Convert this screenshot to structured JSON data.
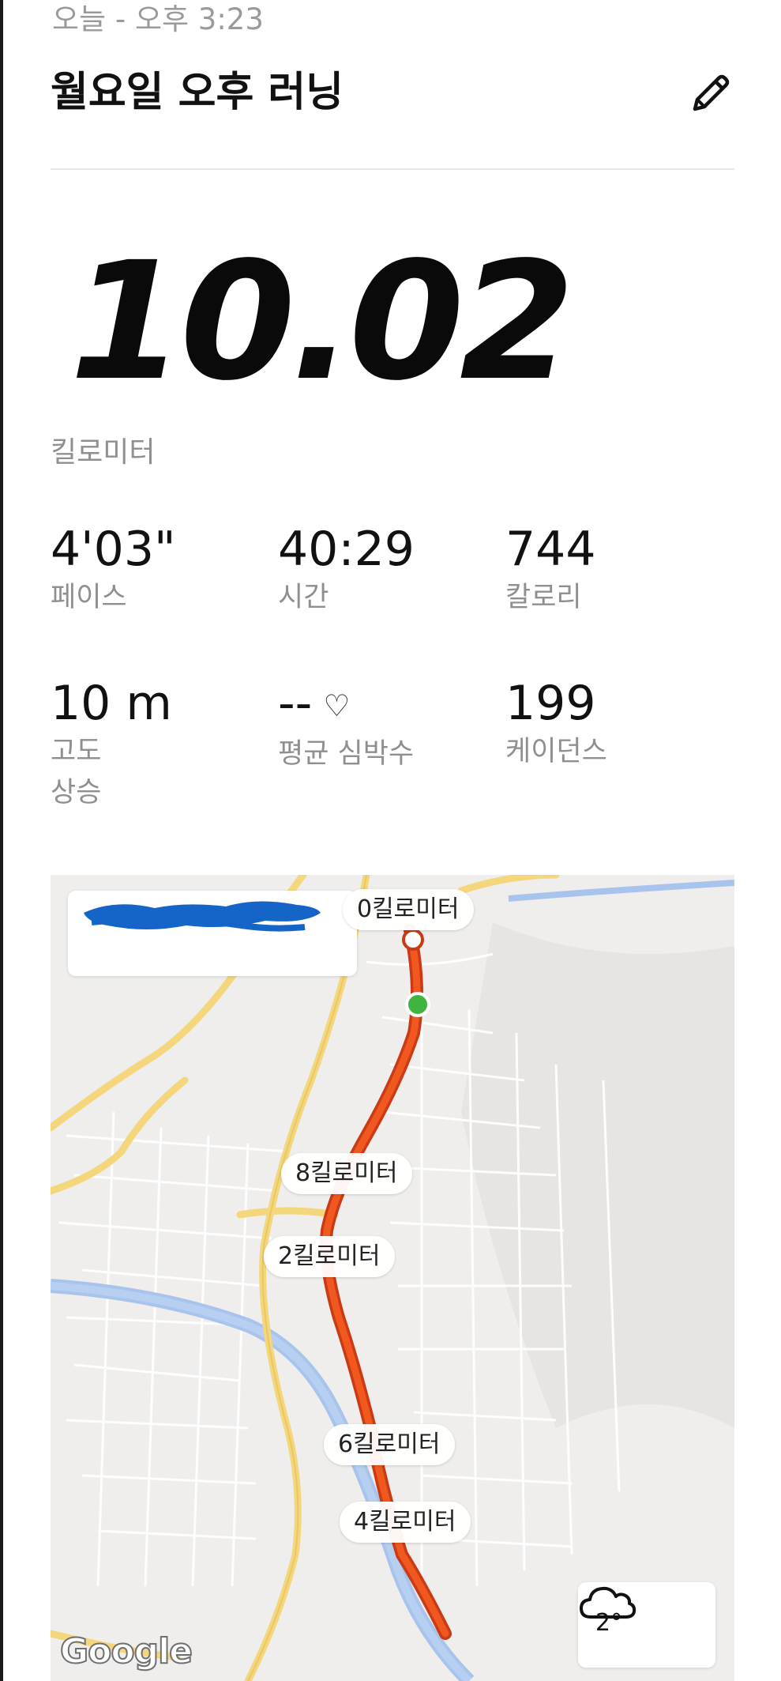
{
  "header": {
    "date": "오늘 - 오후 3:23",
    "title": "월요일 오후 러닝",
    "edit_icon": "pencil-icon"
  },
  "summary": {
    "distance": "10.02",
    "distance_unit": "킬로미터"
  },
  "stats": [
    {
      "value": "4'03\"",
      "label": "페이스"
    },
    {
      "value": "40:29",
      "label": "시간"
    },
    {
      "value": "744",
      "label": "칼로리"
    },
    {
      "value": "10 m",
      "label": "고도\n상승"
    },
    {
      "value": "--",
      "label": "평균 심박수",
      "icon": "heart-icon"
    },
    {
      "value": "199",
      "label": "케이던스"
    }
  ],
  "map": {
    "markers": {
      "km0": "0킬로미터",
      "km8": "8킬로미터",
      "km2": "2킬로미터",
      "km6": "6킬로미터",
      "km4": "4킬로미터"
    },
    "weather": {
      "temperature": "2°",
      "icon": "cloud-icon"
    },
    "attribution": "Google",
    "route_color": "#e8461c",
    "start_color": "#3fb43f",
    "road_color": "#f4d77c",
    "river_color": "#a9c4ec",
    "redaction_color": "#1565c8"
  }
}
